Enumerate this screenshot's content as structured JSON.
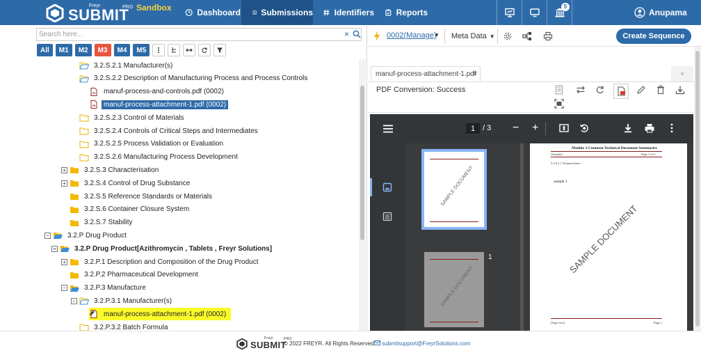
{
  "brand": {
    "small_top": "Freyr",
    "name": "SUBMIT",
    "pro": "PRO",
    "env": "Sandbox"
  },
  "nav": {
    "dashboard": "Dashboard",
    "submissions": "Submissions",
    "identifiers": "Identifiers",
    "reports": "Reports",
    "notification_count": "5",
    "user_name": "Anupama"
  },
  "search": {
    "placeholder": "Search here...",
    "value": "",
    "clear": "×"
  },
  "filters": [
    "All",
    "M1",
    "M2",
    "M3",
    "M4",
    "M5"
  ],
  "tree": [
    {
      "label": "3.2.S.2.1 Manufacturer(s)",
      "type": "folder-open-empty"
    },
    {
      "label": "3.2.S.2.2 Description of Manufacturing Process and Process Controls",
      "type": "folder-open-empty"
    },
    {
      "label": "manuf-process-and-controls.pdf (0002)",
      "type": "pdf"
    },
    {
      "label": "manuf-process-attachment-1.pdf (0002)",
      "type": "pdf",
      "state": "selected"
    },
    {
      "label": "3.2.S.2.3 Control of Materials",
      "type": "folder-empty"
    },
    {
      "label": "3.2.S.2.4 Controls of Critical Steps and Intermediates",
      "type": "folder-empty"
    },
    {
      "label": "3.2.S.2.5 Process Validation or Evaluation",
      "type": "folder-empty"
    },
    {
      "label": "3.2.S.2.6 Manufacturing Process Development",
      "type": "folder-empty"
    },
    {
      "label": "3.2.S.3 Characterisation",
      "type": "folder",
      "expander": "+"
    },
    {
      "label": "3.2.S.4 Control of Drug Substance",
      "type": "folder",
      "expander": "+"
    },
    {
      "label": "3.2.S.5 Reference Standards or Materials",
      "type": "folder"
    },
    {
      "label": "3.2.S.6 Container Closure System",
      "type": "folder"
    },
    {
      "label": "3.2.S.7 Stability",
      "type": "folder"
    },
    {
      "label": "3.2.P Drug Product",
      "type": "folder-open",
      "expander": "−"
    },
    {
      "label": "3.2.P Drug Product[Azithromycin , Tablets , Freyr Solutions]",
      "type": "folder-open",
      "expander": "−",
      "bold": true
    },
    {
      "label": "3.2.P.1 Description and Composition of the Drug Product",
      "type": "folder",
      "expander": "+"
    },
    {
      "label": "3.2.P.2 Pharmaceutical Development",
      "type": "folder"
    },
    {
      "label": "3.2.P.3 Manufacture",
      "type": "folder-open",
      "expander": "−"
    },
    {
      "label": "3.2.P.3.1 Manufacturer(s)",
      "type": "folder-open-empty",
      "expander": "−"
    },
    {
      "label": "manuf-process-attachment-1.pdf (0002)",
      "type": "pdf-edit",
      "state": "highlighted"
    },
    {
      "label": "3.2.P.3.2 Batch Formula",
      "type": "folder-empty"
    }
  ],
  "toolbar": {
    "manage_link": "0002(Manage)",
    "meta_data": "Meta Data",
    "create_sequence": "Create Sequence"
  },
  "document": {
    "tab_name": "manuf-process-attachment-1.pdf",
    "tab_close": "×",
    "conversion_status": "PDF Conversion: Success"
  },
  "pdf_viewer": {
    "current_page": "1",
    "page_count_text": "/  3",
    "thumb_label": "1",
    "page_header": "Module 3-Common Technical Document Summaries",
    "page_left_tag": "[Sample]",
    "page_right_tag": "Page 1 of 3",
    "section": "3.2.S.1.1 Nomenclature",
    "body_text": "sample 1",
    "watermark": "SAMPLE DOCUMENT",
    "footer_left": "[Type text]",
    "footer_right": "Page 1"
  },
  "footer": {
    "logo_small": "Freyr",
    "logo_name": "SUBMIT",
    "logo_pro": "PRO",
    "copyright": "© 2022 FREYR. All Rights Reserved.",
    "email": "submitsupport@FreyrSolutions.com"
  },
  "colors": {
    "primary": "#2d6aa8",
    "nav_active": "#1f5288",
    "m3_active": "#e8553e",
    "highlight": "#fafa2a",
    "folder": "#f5b800",
    "env_label": "#f5d33a"
  }
}
